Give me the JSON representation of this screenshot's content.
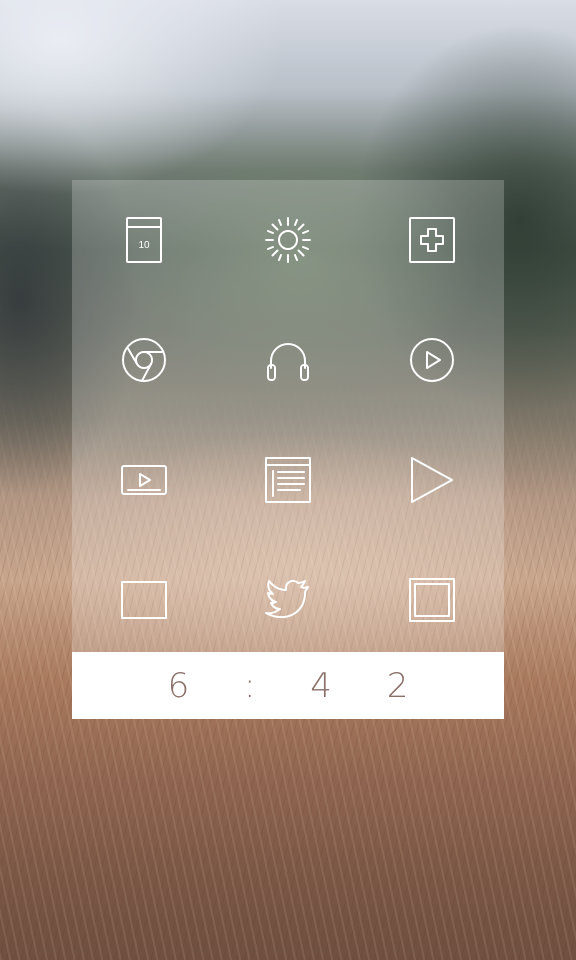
{
  "clock": {
    "time": "6 : 4 2"
  },
  "calendar_date": "10",
  "icons": [
    {
      "row": 0,
      "col": 0,
      "name": "calendar-icon"
    },
    {
      "row": 0,
      "col": 1,
      "name": "weather-sun-icon"
    },
    {
      "row": 0,
      "col": 2,
      "name": "plus-add-icon"
    },
    {
      "row": 1,
      "col": 0,
      "name": "chrome-browser-icon"
    },
    {
      "row": 1,
      "col": 1,
      "name": "headphones-music-icon"
    },
    {
      "row": 1,
      "col": 2,
      "name": "play-circle-video-icon"
    },
    {
      "row": 2,
      "col": 0,
      "name": "video-player-icon"
    },
    {
      "row": 2,
      "col": 1,
      "name": "news-reader-icon"
    },
    {
      "row": 2,
      "col": 2,
      "name": "play-store-icon"
    },
    {
      "row": 3,
      "col": 0,
      "name": "square-frame-icon"
    },
    {
      "row": 3,
      "col": 1,
      "name": "twitter-bird-icon"
    },
    {
      "row": 3,
      "col": 2,
      "name": "gallery-frame-icon"
    }
  ],
  "colors": {
    "clock_text": "#8a7068",
    "icon_stroke": "#ffffff",
    "clock_bar": "#ffffff"
  }
}
